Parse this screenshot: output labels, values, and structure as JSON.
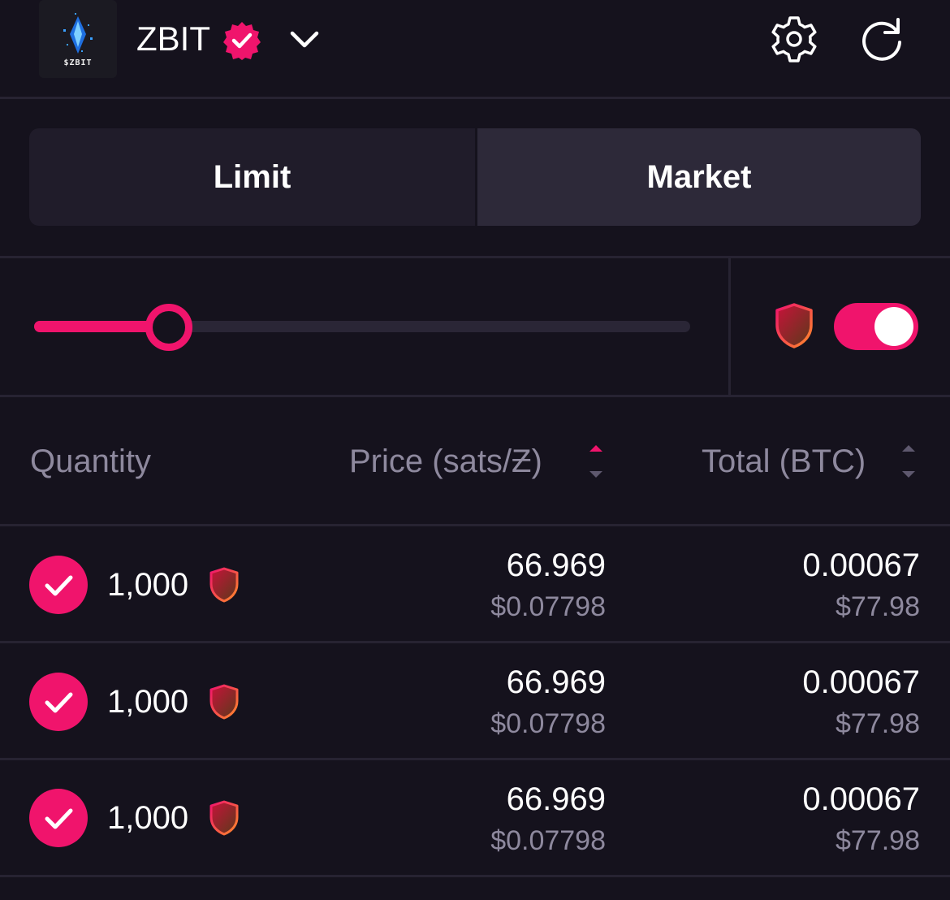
{
  "header": {
    "logo_text": "$ZBIT",
    "token_name": "ZBIT"
  },
  "order_type": {
    "tabs": [
      {
        "label": "Limit",
        "selected": false
      },
      {
        "label": "Market",
        "selected": true
      }
    ]
  },
  "controls": {
    "slider_value_fraction": 0.205,
    "protection_toggle_on": true
  },
  "table": {
    "columns": [
      "Quantity",
      "Price (sats/Ƶ)",
      "Total (BTC)"
    ],
    "rows": [
      {
        "quantity": "1,000",
        "price": "66.969",
        "price_usd": "$0.07798",
        "total": "0.00067",
        "total_usd": "$77.98",
        "checked": true
      },
      {
        "quantity": "1,000",
        "price": "66.969",
        "price_usd": "$0.07798",
        "total": "0.00067",
        "total_usd": "$77.98",
        "checked": true
      },
      {
        "quantity": "1,000",
        "price": "66.969",
        "price_usd": "$0.07798",
        "total": "0.00067",
        "total_usd": "$77.98",
        "checked": true
      }
    ]
  },
  "colors": {
    "background": "#15121d",
    "accent": "#f0146c",
    "muted_text": "#8e899e",
    "divider": "#272332"
  }
}
